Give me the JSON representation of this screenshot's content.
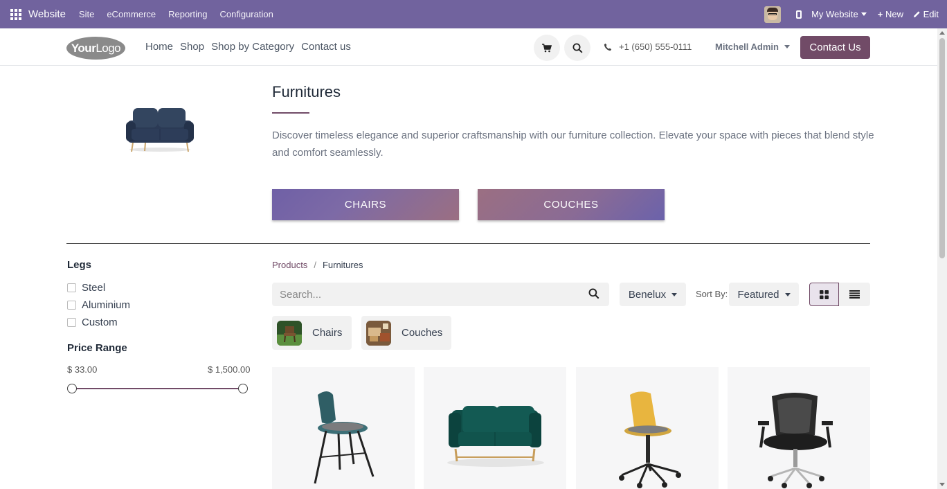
{
  "adminbar": {
    "brand": "Website",
    "menu": [
      "Site",
      "eCommerce",
      "Reporting",
      "Configuration"
    ],
    "website_label": "My Website",
    "new_label": "New",
    "edit_label": "Edit"
  },
  "header": {
    "logo_bold": "Your",
    "logo_light": "Logo",
    "nav": [
      "Home",
      "Shop",
      "Shop by Category",
      "Contact us"
    ],
    "phone": "+1 (650) 555-0111",
    "user": "Mitchell Admin",
    "contact_button": "Contact Us"
  },
  "hero": {
    "title": "Furnitures",
    "description": "Discover timeless elegance and superior craftsmanship with our furniture collection. Elevate your space with pieces that blend style and comfort seamlessly.",
    "subcategories": [
      "CHAIRS",
      "COUCHES"
    ]
  },
  "filters": {
    "legs_title": "Legs",
    "legs_options": [
      "Steel",
      "Aluminium",
      "Custom"
    ],
    "price_title": "Price Range",
    "price_min": "$ 33.00",
    "price_max": "$ 1,500.00"
  },
  "products": {
    "breadcrumb": [
      "Products",
      "Furnitures"
    ],
    "search_placeholder": "Search...",
    "pricelist": "Benelux",
    "sort_label": "Sort By:",
    "sort_value": "Featured",
    "category_chips": [
      "Chairs",
      "Couches"
    ]
  },
  "colors": {
    "admin_bar": "#71639e",
    "brand_primary": "#714b67"
  }
}
